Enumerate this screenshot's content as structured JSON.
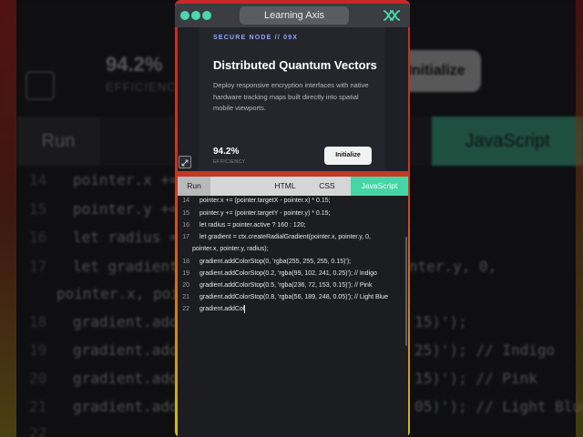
{
  "background": {
    "efficiency_value": "94.2%",
    "efficiency_label": "EFFICIENCY",
    "initialize_label": "Initialize",
    "run_label": "Run",
    "javascript_label": "JavaScript",
    "lines": [
      {
        "num": "14",
        "left": "pointer.x += (",
        "right": ""
      },
      {
        "num": "15",
        "left": "pointer.y += (",
        "right": ""
      },
      {
        "num": "16",
        "left": "let radius = po",
        "right": ""
      },
      {
        "num": "17",
        "left": "let gradient =",
        "right": "pointer.y, 0,"
      },
      {
        "num": "",
        "left": "pointer.x, pointe",
        "right": ""
      },
      {
        "num": "18",
        "left": "gradient.addC",
        "right": "15)');"
      },
      {
        "num": "19",
        "left": "gradient.addC",
        "right": "25)'); // Indigo"
      },
      {
        "num": "20",
        "left": "gradient.addC",
        "right": "15)'); // Pink"
      },
      {
        "num": "21",
        "left": "gradient.addC",
        "right": "05)'); // Light Blue"
      },
      {
        "num": "22",
        "left": "",
        "right": ""
      }
    ]
  },
  "app": {
    "title": "Learning Axis",
    "accent": "#45d6a5"
  },
  "preview": {
    "eyebrow": "SECURE NODE // 09X",
    "headline": "Distributed Quantum Vectors",
    "description": "Deploy responsive encryption interfaces with native hardware tracking maps built directly into spatial mobile viewports.",
    "efficiency_value": "94.2%",
    "efficiency_label": "EFFICIENCY",
    "initialize_label": "Initialize"
  },
  "tabs": {
    "run": "Run",
    "html": "HTML",
    "css": "CSS",
    "javascript": "JavaScript"
  },
  "code_lines": [
    {
      "num": "14",
      "text": "pointer.x += (pointer.targetX - pointer.x) * 0.15;"
    },
    {
      "num": "15",
      "text": "pointer.y += (pointer.targetY - pointer.y) * 0.15;"
    },
    {
      "num": "16",
      "text": "let radius = pointer.active ? 160 : 120;"
    },
    {
      "num": "17",
      "text": "let gradient = ctx.createRadialGradient(pointer.x, pointer.y, 0,"
    },
    {
      "num": "",
      "text": "pointer.x, pointer.y, radius);"
    },
    {
      "num": "18",
      "text": "gradient.addColorStop(0, 'rgba(255, 255, 255, 0.15)');"
    },
    {
      "num": "19",
      "text": "gradient.addColorStop(0.2, 'rgba(99, 102, 241, 0.25)'); // Indigo"
    },
    {
      "num": "20",
      "text": "gradient.addColorStop(0.5, 'rgba(236, 72, 153, 0.15)'); // Pink"
    },
    {
      "num": "21",
      "text": "gradient.addColorStop(0.8, 'rgba(56, 189, 248, 0.05)'); // Light Blue"
    },
    {
      "num": "22",
      "text": "gradient.addCol"
    }
  ]
}
